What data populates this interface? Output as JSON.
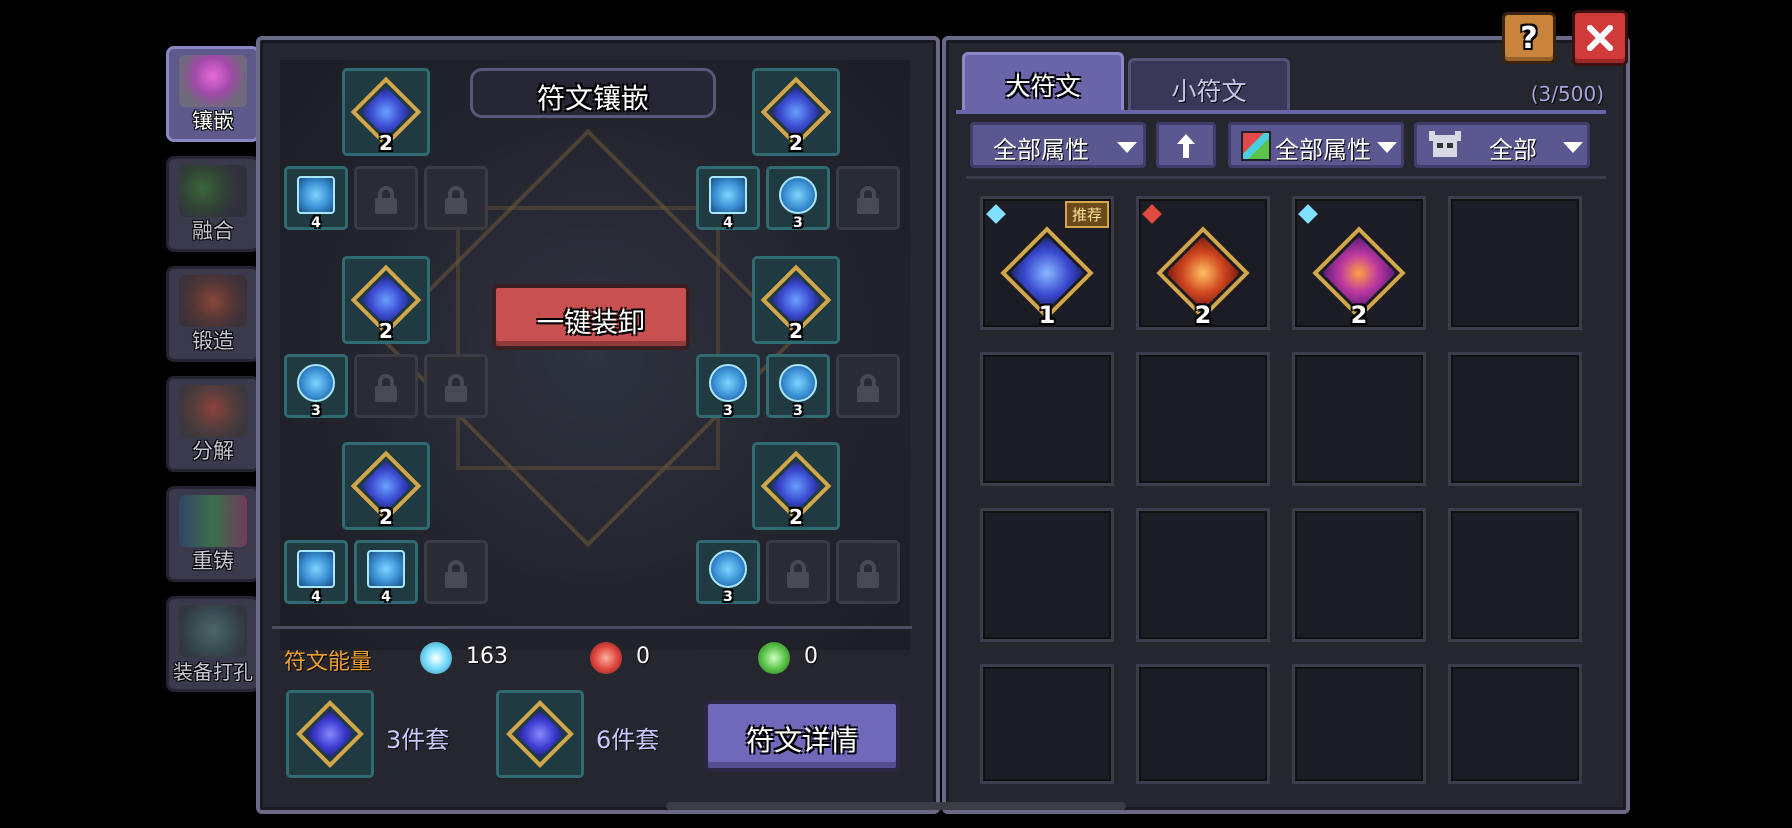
{
  "side_tabs": [
    {
      "label": "镶嵌",
      "icon": "inlay-icon",
      "active": true
    },
    {
      "label": "融合",
      "icon": "fusion-icon",
      "active": false
    },
    {
      "label": "锻造",
      "icon": "forge-icon",
      "active": false
    },
    {
      "label": "分解",
      "icon": "decompose-icon",
      "active": false
    },
    {
      "label": "重铸",
      "icon": "recast-icon",
      "active": false
    },
    {
      "label": "装备打孔",
      "icon": "socket-punch-icon",
      "active": false
    }
  ],
  "inlay_panel": {
    "title": "符文镶嵌",
    "unequip_all_label": "一键装卸",
    "big_slots": [
      {
        "level": "2"
      },
      {
        "level": "2"
      },
      {
        "level": "2"
      },
      {
        "level": "2"
      },
      {
        "level": "2"
      },
      {
        "level": "2"
      }
    ],
    "small_runes": [
      "4",
      "4",
      "3",
      "3",
      "3",
      "3",
      "4",
      "4",
      "3"
    ]
  },
  "energy": {
    "label": "符文能量",
    "values": [
      {
        "icon": "blue-energy-icon",
        "value": "163",
        "color": "#7fe0ff"
      },
      {
        "icon": "red-energy-icon",
        "value": "0",
        "color": "#e0483f"
      },
      {
        "icon": "green-energy-icon",
        "value": "0",
        "color": "#5ac44a"
      }
    ]
  },
  "sets": [
    {
      "label": "3件套"
    },
    {
      "label": "6件套"
    }
  ],
  "rune_detail_label": "符文详情",
  "inventory": {
    "tabs": [
      {
        "label": "大符文",
        "active": true
      },
      {
        "label": "小符文",
        "active": false
      }
    ],
    "count": "(3/500)",
    "filters": {
      "attribute_1": "全部属性",
      "attribute_2": "全部属性",
      "type": "全部"
    },
    "recommend_badge": "推荐",
    "items": [
      {
        "level": "1",
        "kind": "blue",
        "recommended": true
      },
      {
        "level": "2",
        "kind": "red",
        "recommended": false
      },
      {
        "level": "2",
        "kind": "purple",
        "recommended": false
      }
    ]
  },
  "colors": {
    "accent": "#5b5790",
    "button_red": "#c85050",
    "gold": "#d2a64a",
    "energy_label": "#f0a030"
  }
}
